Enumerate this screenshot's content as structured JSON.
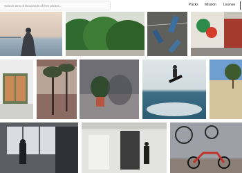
{
  "search": {
    "placeholder": "Search tens of thousands of free photos..."
  },
  "nav": {
    "packs": "Packs",
    "mission": "Mission",
    "license": "License"
  },
  "photos": [
    {
      "subject": "person-on-pier-sunset"
    },
    {
      "subject": "hedge-bushes"
    },
    {
      "subject": "clothespins"
    },
    {
      "subject": "graffiti-building"
    },
    {
      "subject": "window-shutters"
    },
    {
      "subject": "palm-trees-sunset"
    },
    {
      "subject": "plant-on-table"
    },
    {
      "subject": "wakeboarding"
    },
    {
      "subject": "tree-and-skate-ramp"
    },
    {
      "subject": "silhouettes-large-windows"
    },
    {
      "subject": "stairwell-person"
    },
    {
      "subject": "scooter-by-mural"
    }
  ]
}
